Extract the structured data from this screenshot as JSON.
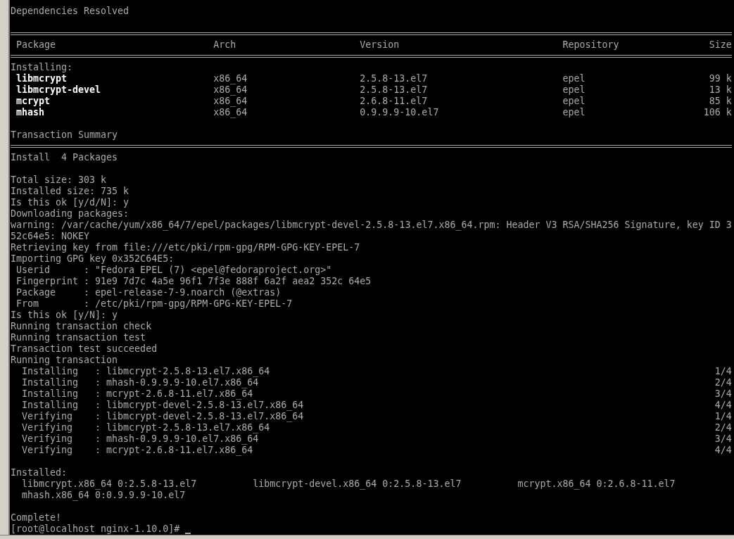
{
  "terminal": {
    "lines": [
      {
        "kind": "text",
        "text": "Dependencies Resolved"
      },
      {
        "kind": "blank"
      },
      {
        "kind": "rule"
      },
      {
        "kind": "header",
        "cells": [
          "Package",
          "Arch",
          "Version",
          "Repository",
          "Size"
        ]
      },
      {
        "kind": "rule"
      },
      {
        "kind": "text",
        "text": "Installing:"
      },
      {
        "kind": "package",
        "cells": [
          "libmcrypt",
          "x86_64",
          "2.5.8-13.el7",
          "epel",
          "99 k"
        ]
      },
      {
        "kind": "package",
        "cells": [
          "libmcrypt-devel",
          "x86_64",
          "2.5.8-13.el7",
          "epel",
          "13 k"
        ]
      },
      {
        "kind": "package",
        "cells": [
          "mcrypt",
          "x86_64",
          "2.6.8-11.el7",
          "epel",
          "85 k"
        ]
      },
      {
        "kind": "package",
        "cells": [
          "mhash",
          "x86_64",
          "0.9.9.9-10.el7",
          "epel",
          "106 k"
        ]
      },
      {
        "kind": "blank"
      },
      {
        "kind": "text",
        "text": "Transaction Summary"
      },
      {
        "kind": "rule"
      },
      {
        "kind": "text",
        "text": "Install  4 Packages"
      },
      {
        "kind": "blank"
      },
      {
        "kind": "text",
        "text": "Total size: 303 k"
      },
      {
        "kind": "text",
        "text": "Installed size: 735 k"
      },
      {
        "kind": "text",
        "text": "Is this ok [y/d/N]: y"
      },
      {
        "kind": "text",
        "text": "Downloading packages:"
      },
      {
        "kind": "text",
        "text": "warning: /var/cache/yum/x86_64/7/epel/packages/libmcrypt-devel-2.5.8-13.el7.x86_64.rpm: Header V3 RSA/SHA256 Signature, key ID 3"
      },
      {
        "kind": "text",
        "text": "52c64e5: NOKEY"
      },
      {
        "kind": "text",
        "text": "Retrieving key from file:///etc/pki/rpm-gpg/RPM-GPG-KEY-EPEL-7"
      },
      {
        "kind": "text",
        "text": "Importing GPG key 0x352C64E5:"
      },
      {
        "kind": "field",
        "label": "Userid",
        "value": ": \"Fedora EPEL (7) <epel@fedoraproject.org>\""
      },
      {
        "kind": "field",
        "label": "Fingerprint",
        "value": ": 91e9 7d7c 4a5e 96f1 7f3e 888f 6a2f aea2 352c 64e5"
      },
      {
        "kind": "field",
        "label": "Package",
        "value": ": epel-release-7-9.noarch (@extras)"
      },
      {
        "kind": "field",
        "label": "From",
        "value": ": /etc/pki/rpm-gpg/RPM-GPG-KEY-EPEL-7"
      },
      {
        "kind": "text",
        "text": "Is this ok [y/N]: y"
      },
      {
        "kind": "text",
        "text": "Running transaction check"
      },
      {
        "kind": "text",
        "text": "Running transaction test"
      },
      {
        "kind": "text",
        "text": "Transaction test succeeded"
      },
      {
        "kind": "text",
        "text": "Running transaction"
      },
      {
        "kind": "step",
        "action": "Installing",
        "item": ": libmcrypt-2.5.8-13.el7.x86_64",
        "count": "1/4"
      },
      {
        "kind": "step",
        "action": "Installing",
        "item": ": mhash-0.9.9.9-10.el7.x86_64",
        "count": "2/4"
      },
      {
        "kind": "step",
        "action": "Installing",
        "item": ": mcrypt-2.6.8-11.el7.x86_64",
        "count": "3/4"
      },
      {
        "kind": "step",
        "action": "Installing",
        "item": ": libmcrypt-devel-2.5.8-13.el7.x86_64",
        "count": "4/4"
      },
      {
        "kind": "step",
        "action": "Verifying",
        "item": ": libmcrypt-devel-2.5.8-13.el7.x86_64",
        "count": "1/4"
      },
      {
        "kind": "step",
        "action": "Verifying",
        "item": ": libmcrypt-2.5.8-13.el7.x86_64",
        "count": "2/4"
      },
      {
        "kind": "step",
        "action": "Verifying",
        "item": ": mhash-0.9.9.9-10.el7.x86_64",
        "count": "3/4"
      },
      {
        "kind": "step",
        "action": "Verifying",
        "item": ": mcrypt-2.6.8-11.el7.x86_64",
        "count": "4/4"
      },
      {
        "kind": "blank"
      },
      {
        "kind": "text",
        "text": "Installed:"
      },
      {
        "kind": "installed",
        "items": [
          "libmcrypt.x86_64 0:2.5.8-13.el7",
          "libmcrypt-devel.x86_64 0:2.5.8-13.el7",
          "mcrypt.x86_64 0:2.6.8-11.el7"
        ]
      },
      {
        "kind": "installed",
        "items": [
          "mhash.x86_64 0:0.9.9.9-10.el7"
        ]
      },
      {
        "kind": "blank"
      },
      {
        "kind": "text",
        "text": "Complete!"
      },
      {
        "kind": "prompt",
        "text": "[root@localhost nginx-1.10.0]#",
        "cursor": true
      }
    ]
  }
}
